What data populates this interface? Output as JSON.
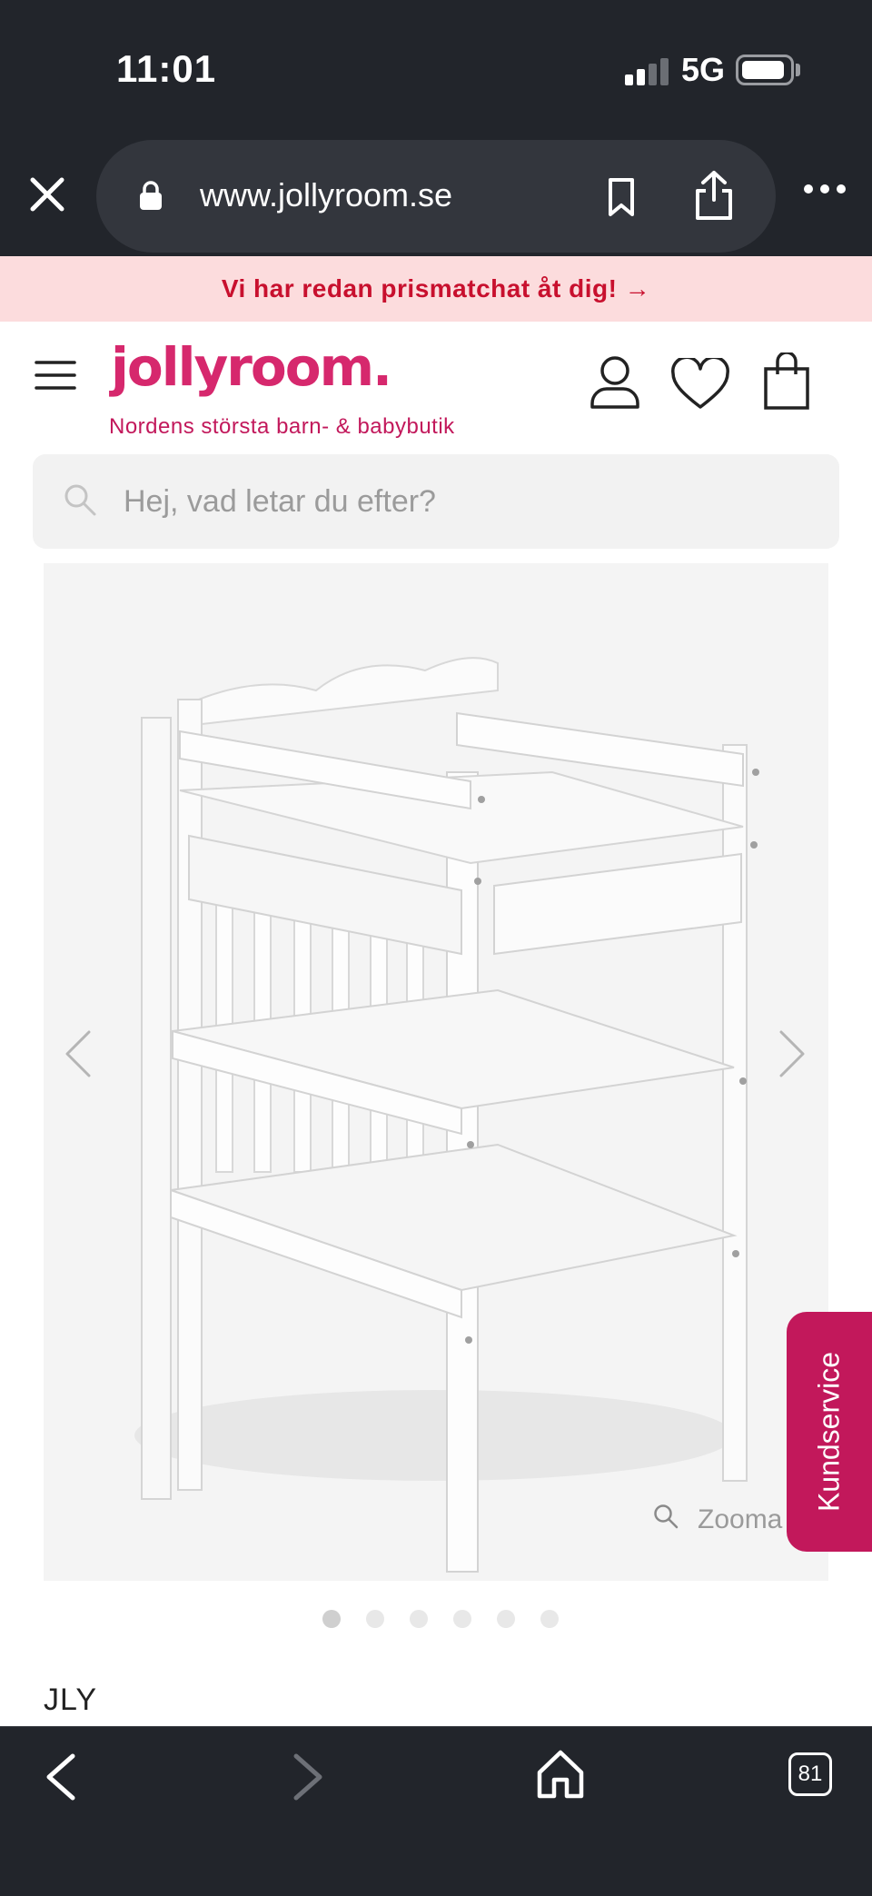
{
  "status_bar": {
    "time": "11:01",
    "network": "5G",
    "signal_bars_active": 2,
    "signal_bars_total": 4,
    "battery_level": 0.8
  },
  "browser": {
    "url": "www.jollyroom.se",
    "icons": [
      "close-icon",
      "lock-icon",
      "bookmark-icon",
      "share-icon",
      "more-icon"
    ]
  },
  "promo": {
    "text": "Vi har redan prismatchat åt dig! →"
  },
  "header": {
    "logo": "jollyroom.",
    "tagline": "Nordens största barn- & babybutik",
    "icons": [
      "menu-icon",
      "account-icon",
      "heart-icon",
      "shopping-bag-icon"
    ]
  },
  "search": {
    "placeholder": "Hej, vad letar du efter?"
  },
  "gallery": {
    "zoom_label": "Zooma",
    "dots_count": 6,
    "active_index": 0
  },
  "kundservice": {
    "label": "Kundservice"
  },
  "product": {
    "brand": "JLY"
  },
  "toolbar": {
    "tab_count": "81"
  },
  "colors": {
    "chrome_dark": "#22252b",
    "brand_pink": "#d6286d",
    "promo_bg": "#fcdcdd",
    "promo_text": "#c8102e",
    "kundservice_bg": "#c2185b"
  }
}
